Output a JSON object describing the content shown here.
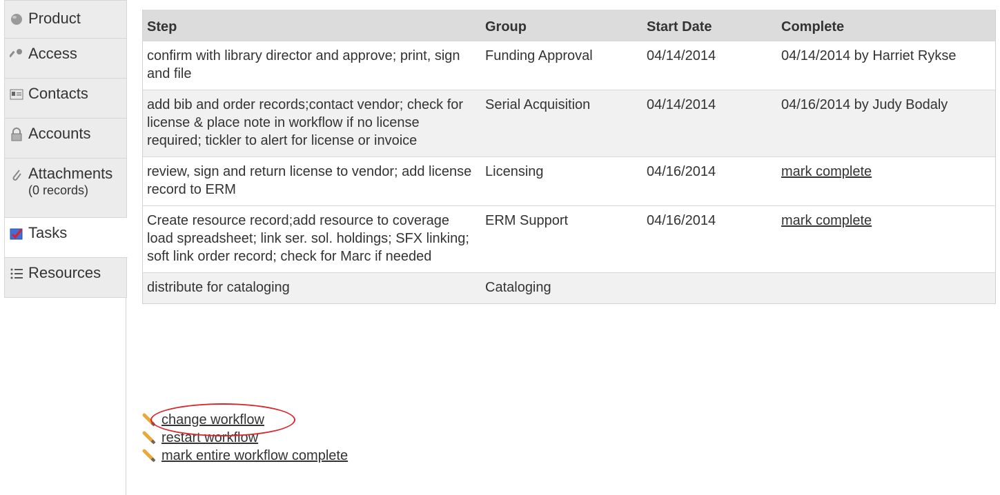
{
  "sidebar": {
    "tabs": [
      {
        "label": "Product",
        "icon": "product-icon"
      },
      {
        "label": "Access",
        "icon": "key-icon"
      },
      {
        "label": "Contacts",
        "icon": "contact-card-icon"
      },
      {
        "label": "Accounts",
        "icon": "lock-icon"
      },
      {
        "label": "Attachments",
        "sub": "(0 records)",
        "icon": "paperclip-icon"
      },
      {
        "label": "Tasks",
        "icon": "checkbox-icon",
        "active": true
      },
      {
        "label": "Resources",
        "icon": "list-icon"
      }
    ]
  },
  "table": {
    "headers": {
      "step": "Step",
      "group": "Group",
      "start_date": "Start Date",
      "complete": "Complete"
    },
    "rows": [
      {
        "step": "confirm with library director and approve; print, sign and file",
        "group": "Funding Approval",
        "start_date": "04/14/2014",
        "complete": "04/14/2014 by Harriet Rykse"
      },
      {
        "step": "add bib and order records;contact vendor; check for license & place note in workflow if no license required; tickler to alert for license or invoice",
        "group": "Serial Acquisition",
        "start_date": "04/14/2014",
        "complete": "04/16/2014 by Judy Bodaly"
      },
      {
        "step": "review, sign and return license to vendor; add license record to ERM",
        "group": "Licensing",
        "start_date": "04/16/2014",
        "complete": "mark complete"
      },
      {
        "step": "Create resource record;add resource to coverage load spreadsheet; link ser. sol. holdings; SFX linking; soft link order record; check for Marc if needed",
        "group": "ERM Support",
        "start_date": "04/16/2014",
        "complete": "mark complete"
      },
      {
        "step": "distribute for cataloging",
        "group": "Cataloging",
        "start_date": "",
        "complete": ""
      }
    ]
  },
  "actions": {
    "change_workflow": "change workflow",
    "restart_workflow": "restart workflow",
    "mark_entire_complete": "mark entire workflow complete"
  },
  "colors": {
    "highlight_oval": "#d9242a",
    "header_bg": "#dcdcdc",
    "tab_bg": "#ececec"
  }
}
